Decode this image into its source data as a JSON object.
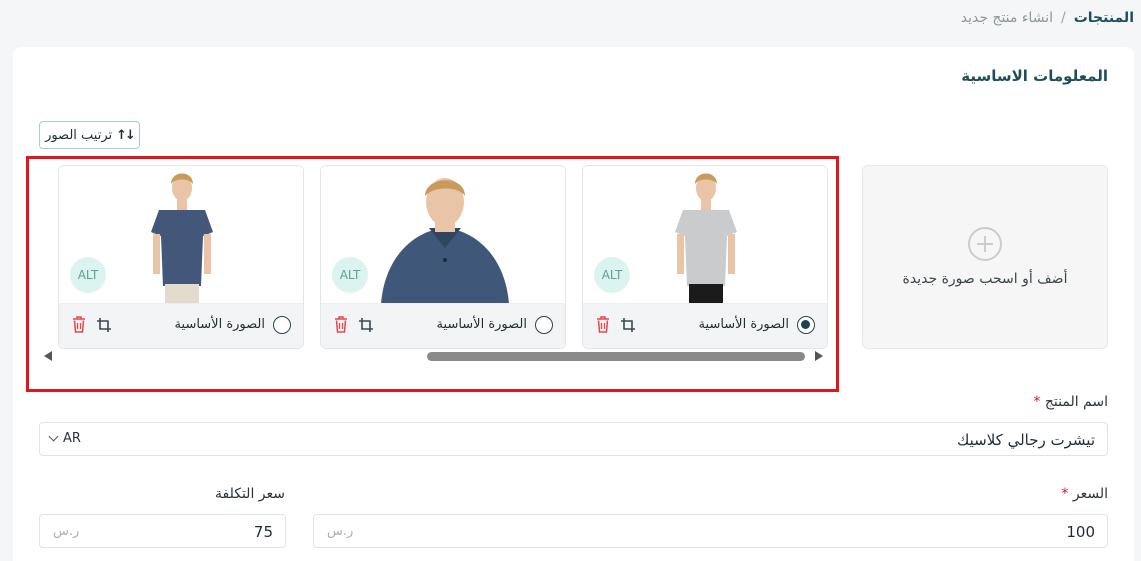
{
  "breadcrumb": {
    "parent": "المنتجات",
    "separator": "/",
    "current": "انشاء منتج جديد"
  },
  "section_title": "المعلومات الاساسية",
  "sort_button": {
    "label": "ترتيب الصور",
    "icon": "sort-arrows-icon"
  },
  "upload": {
    "label": "أضف أو اسحب صورة جديدة",
    "icon": "plus-circle-icon"
  },
  "images": [
    {
      "primary_label": "الصورة الأساسية",
      "selected": true,
      "alt_label": "ALT",
      "shirt_color": "#c9cbcd",
      "pants_color": "#1b1b1b",
      "variant": "full"
    },
    {
      "primary_label": "الصورة الأساسية",
      "selected": false,
      "alt_label": "ALT",
      "shirt_color": "#3f5778",
      "pants_color": "#3f5778",
      "variant": "close"
    },
    {
      "primary_label": "الصورة الأساسية",
      "selected": false,
      "alt_label": "ALT",
      "shirt_color": "#42577a",
      "pants_color": "#e3dccd",
      "variant": "full"
    }
  ],
  "product_name": {
    "label": "اسم المنتج",
    "required_mark": "*",
    "value": "تيشرت رجالي كلاسيك",
    "language": "AR"
  },
  "price": {
    "label": "السعر",
    "required_mark": "*",
    "value": "100",
    "currency": "ر.س"
  },
  "cost_price": {
    "label": "سعر التكلفة",
    "value": "75",
    "currency": "ر.س"
  },
  "colors": {
    "accent": "#1e4e5a",
    "highlight": "#e0161e",
    "danger": "#e5484d",
    "alt_badge": "#dcf4ef"
  }
}
